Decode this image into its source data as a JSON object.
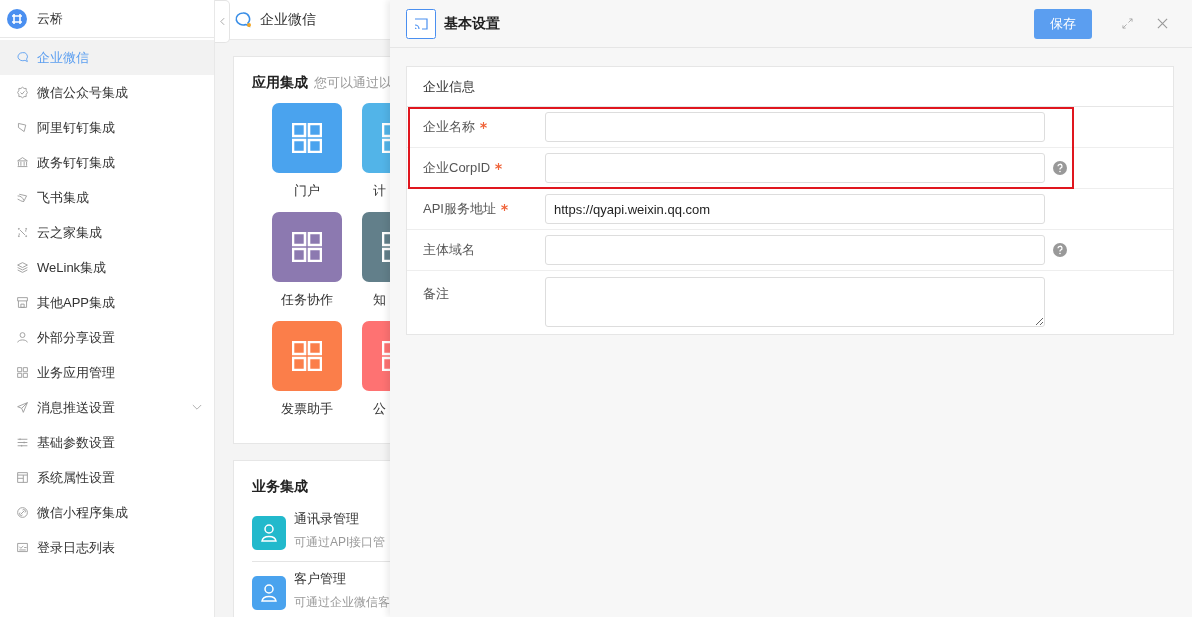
{
  "app": {
    "name": "云桥"
  },
  "sidebar": {
    "items": [
      {
        "label": "企业微信",
        "selected": true,
        "expandable": false
      },
      {
        "label": "微信公众号集成",
        "selected": false,
        "expandable": false
      },
      {
        "label": "阿里钉钉集成",
        "selected": false,
        "expandable": false
      },
      {
        "label": "政务钉钉集成",
        "selected": false,
        "expandable": false
      },
      {
        "label": "飞书集成",
        "selected": false,
        "expandable": false
      },
      {
        "label": "云之家集成",
        "selected": false,
        "expandable": false
      },
      {
        "label": "WeLink集成",
        "selected": false,
        "expandable": false
      },
      {
        "label": "其他APP集成",
        "selected": false,
        "expandable": false
      },
      {
        "label": "外部分享设置",
        "selected": false,
        "expandable": false
      },
      {
        "label": "业务应用管理",
        "selected": false,
        "expandable": false
      },
      {
        "label": "消息推送设置",
        "selected": false,
        "expandable": true
      },
      {
        "label": "基础参数设置",
        "selected": false,
        "expandable": false
      },
      {
        "label": "系统属性设置",
        "selected": false,
        "expandable": false
      },
      {
        "label": "微信小程序集成",
        "selected": false,
        "expandable": false
      },
      {
        "label": "登录日志列表",
        "selected": false,
        "expandable": false
      }
    ]
  },
  "main": {
    "title": "企业微信",
    "app_section": {
      "title": "应用集成",
      "description": "您可以通过以",
      "tiles": [
        {
          "label": "门户",
          "color": "#4aa3ee"
        },
        {
          "label": "计",
          "color": "#52b4e8"
        },
        {
          "label": "任务协作",
          "color": "#8c79b0"
        },
        {
          "label": "知",
          "color": "#627f8a"
        },
        {
          "label": "发票助手",
          "color": "#fb7e4a"
        },
        {
          "label": "公",
          "color": "#fe7272"
        }
      ]
    },
    "business_section": {
      "title": "业务集成",
      "items": [
        {
          "title": "通讯录管理",
          "description": "可通过API接口管",
          "color": "#22b9cc"
        },
        {
          "title": "客户管理",
          "description": "可通过企业微信客",
          "color": "#4aa3ee"
        }
      ]
    }
  },
  "panel": {
    "title": "基本设置",
    "save_button": "保存",
    "form": {
      "title": "企业信息",
      "fields": [
        {
          "label": "企业名称",
          "required": true,
          "help": false,
          "multiline": false,
          "highlighted": true
        },
        {
          "label": "企业CorpID",
          "required": true,
          "help": true,
          "multiline": false,
          "highlighted": true
        },
        {
          "label": "API服务地址",
          "required": true,
          "value": "https://qyapi.weixin.qq.com",
          "help": false,
          "multiline": false,
          "highlighted": false
        },
        {
          "label": "主体域名",
          "required": false,
          "help": true,
          "multiline": false,
          "highlighted": false
        },
        {
          "label": "备注",
          "required": false,
          "help": false,
          "multiline": true,
          "highlighted": false
        }
      ]
    }
  }
}
